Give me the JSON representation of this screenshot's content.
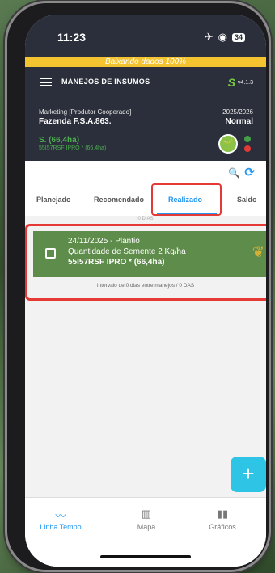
{
  "status_bar": {
    "time": "11:23",
    "battery": "34"
  },
  "sync_banner": "Baixando dados 100%",
  "header": {
    "title": "MANEJOS DE INSUMOS",
    "version": "v4.1.3",
    "role": "Marketing [Produtor Cooperado]",
    "farm": "Fazenda F.S.A.863.",
    "season": "2025/2026",
    "season_status": "Normal",
    "area": "S. (66,4ha)",
    "variety": "55I57RSF IPRO * (66,4ha)"
  },
  "tabs": [
    {
      "label": "Planejado",
      "active": false
    },
    {
      "label": "Recomendado",
      "active": false
    },
    {
      "label": "Realizado",
      "active": true
    },
    {
      "label": "Saldo",
      "active": false
    }
  ],
  "faded_label": "0 DIAS",
  "record": {
    "line1": "24/11/2025 - Plantio",
    "line2": "Quantidade de Semente 2 Kg/ha",
    "line3": "55I57RSF IPRO * (66,4ha)",
    "crop_icon": "soy-pod-icon"
  },
  "interval_text": "Intervalo de 0 dias entre manejos / 0 DAS",
  "fab_label": "+",
  "bottom_nav": [
    {
      "label": "Linha Tempo",
      "icon": "timeline-icon",
      "active": true
    },
    {
      "label": "Mapa",
      "icon": "map-icon",
      "active": false
    },
    {
      "label": "Gráficos",
      "icon": "chart-icon",
      "active": false
    }
  ],
  "colors": {
    "header_bg": "#2b2f3b",
    "banner": "#f4c430",
    "accent": "#2196f3",
    "card_green": "#5e8c4a",
    "highlight_red": "#e53935",
    "fab": "#2ec4e6"
  }
}
